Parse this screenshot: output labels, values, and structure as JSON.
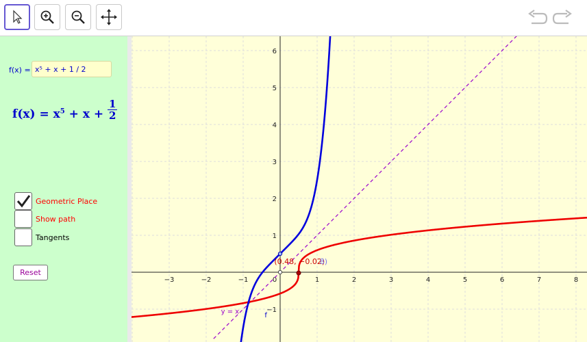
{
  "toolbar": {
    "tools": [
      "move-tool",
      "zoom-in-tool",
      "zoom-out-tool",
      "move-view-tool"
    ]
  },
  "sidebar": {
    "fx_label": "f(x) =",
    "fx_input_value": "x⁵ + x + 1 / 2",
    "formula": {
      "lhs": "f(x) = x",
      "exp": "5",
      "rhs": " + x + ",
      "num": "1",
      "den": "2"
    },
    "checkboxes": [
      {
        "label": "Geometric Place",
        "checked": true,
        "color": "#ff0000"
      },
      {
        "label": "Show path",
        "checked": false,
        "color": "#ff0000"
      },
      {
        "label": "Tangents",
        "checked": false,
        "color": "#000000"
      }
    ],
    "reset_label": "Reset"
  },
  "graph": {
    "x_ticks": [
      "−3",
      "−2",
      "−1",
      "0",
      "1",
      "2",
      "3",
      "4",
      "5",
      "6",
      "7",
      "8"
    ],
    "y_ticks": [
      "−1",
      "1",
      "2",
      "3",
      "4",
      "5",
      "6"
    ],
    "point_label": "(0.48, −0.02)",
    "line_label": "y = x",
    "curve_label": "f",
    "extra_label": "8)"
  },
  "colors": {
    "blue_curve": "#0000dd",
    "red_curve": "#ee0000",
    "dashed_line": "#9900cc",
    "graph_bg": "#ffffd9",
    "sidebar_bg": "#ccffcc"
  }
}
